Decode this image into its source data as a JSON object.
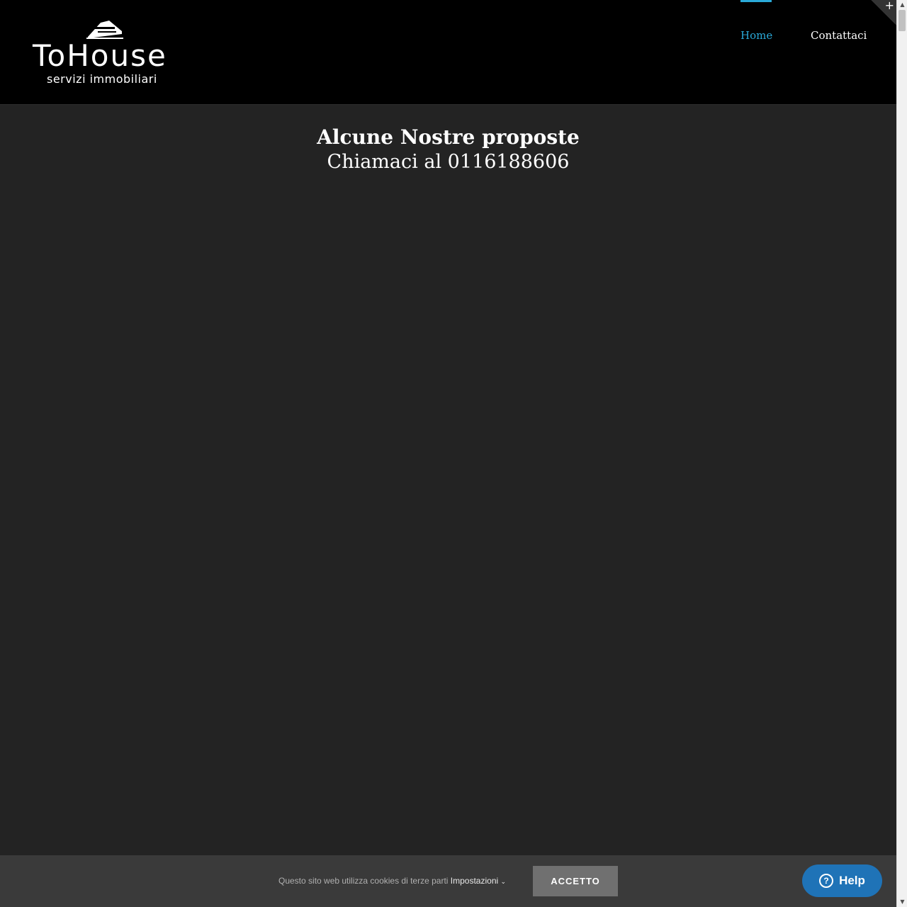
{
  "header": {
    "logo": {
      "wordmark": "ToHouse",
      "tagline": "servizi immobiliari"
    },
    "nav": [
      {
        "label": "Home",
        "active": true
      },
      {
        "label": "Contattaci",
        "active": false
      }
    ],
    "corner_toggle_icon": "+"
  },
  "main": {
    "title": "Alcune Nostre proposte",
    "subtitle": "Chiamaci al 0116188606"
  },
  "cookie_bar": {
    "text": "Questo sito web utilizza cookies di terze parti",
    "settings_label": "Impostazioni",
    "accept_label": "ACCETTO"
  },
  "help_widget": {
    "label": "Help",
    "icon": "question-icon"
  },
  "colors": {
    "accent": "#2aa9d8",
    "header_bg": "#000000",
    "page_bg": "#232323",
    "cookie_bg": "#3a3a3a",
    "help_bg": "#1f73b7"
  }
}
